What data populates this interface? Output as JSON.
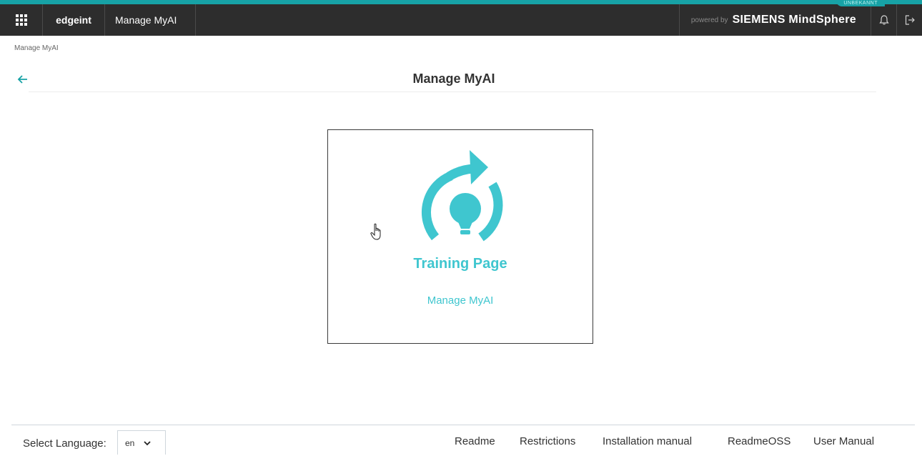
{
  "topbar": {
    "tenant": "edgeint",
    "app_name": "Manage MyAI",
    "powered_by": "powered by",
    "brand": "SIEMENS MindSphere",
    "env_badge": "UNBEKANNT"
  },
  "breadcrumb": "Manage MyAI",
  "page_title": "Manage MyAI",
  "card": {
    "title": "Training Page",
    "subtitle": "Manage MyAI",
    "icon": "training-bulb-icon",
    "accent_color": "#3fc6cf"
  },
  "footer": {
    "language_label": "Select Language:",
    "language_value": "en",
    "links": [
      "Readme",
      "Restrictions",
      "Installation manual",
      "ReadmeOSS",
      "User Manual"
    ]
  },
  "colors": {
    "topbar_bg": "#2d2d2d",
    "topbar_accent": "#17a2a6",
    "accent": "#3fc6cf"
  }
}
